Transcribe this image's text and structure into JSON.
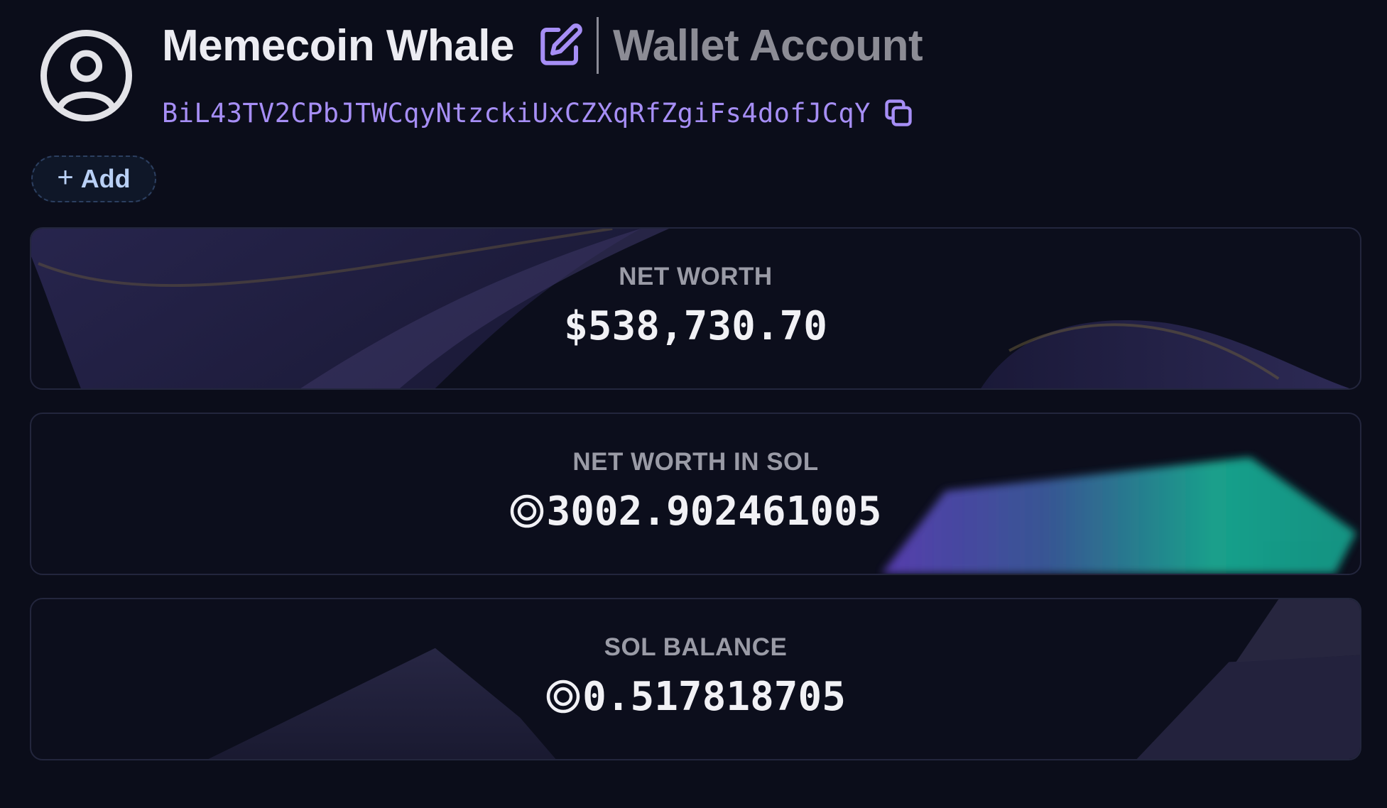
{
  "header": {
    "avatar_icon": "user-circle-icon",
    "wallet_name": "Memecoin Whale",
    "edit_icon": "pencil-edit-icon",
    "account_type": "Wallet Account",
    "address": "BiL43TV2CPbJTWCqyNtzckiUxCZXqRfZgiFs4dofJCqY",
    "copy_icon": "copy-icon"
  },
  "add_button": {
    "label": "Add",
    "icon": "plus-icon"
  },
  "cards": [
    {
      "label": "NET WORTH",
      "value": "$538,730.70"
    },
    {
      "label": "NET WORTH IN SOL",
      "value": "3002.902461005",
      "icon": "sol-icon"
    },
    {
      "label": "SOL BALANCE",
      "value": "0.517818705",
      "icon": "sol-icon"
    }
  ],
  "colors": {
    "background": "#0b0d1a",
    "accent_purple": "#a68ef5",
    "add_button_text": "#b9d0f5",
    "teal_accent": "#1aa891"
  }
}
